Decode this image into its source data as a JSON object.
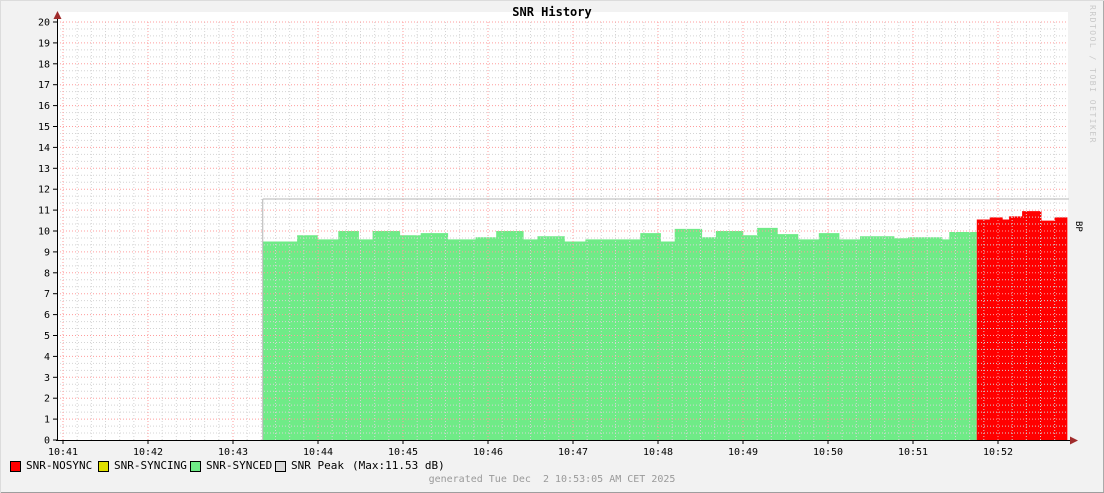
{
  "header": {
    "title": "SNR History"
  },
  "watermark": "RRDTOOL / TOBI OETIKER",
  "right_axis_label": "BP",
  "footer": {
    "generated": "generated Tue Dec  2 10:53:05 AM CET 2025"
  },
  "legend": {
    "items": [
      {
        "label": "SNR-NOSYNC",
        "color": "#FF0000"
      },
      {
        "label": "SNR-SYNCING",
        "color": "#E0E000"
      },
      {
        "label": "SNR-SYNCED",
        "color": "#6FEB87"
      },
      {
        "label": "SNR Peak",
        "color": "#D9D9D9"
      }
    ],
    "max_note": "(Max:11.53 dB)"
  },
  "colors": {
    "plot_background": "#FFFFFF",
    "outer_background": "#F2F2F2",
    "axis": "#000000",
    "arrow": "#A02C2C",
    "grid_major": "#FF9D9D",
    "grid_minor": "#D4D4D4",
    "peak_line": "#B4B4B4",
    "label_text": "#000000",
    "footer_text": "#9A9A9A",
    "watermark_text": "#C9C9C9"
  },
  "chart_data": {
    "type": "area",
    "title": "SNR History",
    "right_axis_label": "BP",
    "ylabel": "",
    "xlabel": "",
    "ylim": [
      0,
      20
    ],
    "y_ticks": [
      0,
      1,
      2,
      3,
      4,
      5,
      6,
      7,
      8,
      9,
      10,
      11,
      12,
      13,
      14,
      15,
      16,
      17,
      18,
      19,
      20
    ],
    "x_ticks": [
      "10:41",
      "10:42",
      "10:43",
      "10:44",
      "10:45",
      "10:46",
      "10:47",
      "10:48",
      "10:49",
      "10:50",
      "10:51",
      "10:52"
    ],
    "x_minor_per_major": 6,
    "y_minor_per_major": 3,
    "grid": true,
    "legend_position": "bottom",
    "sample_seconds": 5,
    "series": [
      {
        "name": "SNR-SYNCED",
        "color": "#6FEB87",
        "start": "10:43:21",
        "end": "10:51:45",
        "rle_values_db": [
          [
            9.5,
            5
          ],
          [
            9.8,
            3
          ],
          [
            9.6,
            3
          ],
          [
            10.0,
            3
          ],
          [
            9.6,
            2
          ],
          [
            10.0,
            4
          ],
          [
            9.8,
            3
          ],
          [
            9.9,
            4
          ],
          [
            9.6,
            4
          ],
          [
            9.7,
            3
          ],
          [
            10.0,
            4
          ],
          [
            9.6,
            2
          ],
          [
            9.75,
            4
          ],
          [
            9.5,
            3
          ],
          [
            9.6,
            8
          ],
          [
            9.9,
            3
          ],
          [
            9.5,
            2
          ],
          [
            10.1,
            4
          ],
          [
            9.7,
            2
          ],
          [
            10.0,
            4
          ],
          [
            9.8,
            2
          ],
          [
            10.15,
            3
          ],
          [
            9.85,
            3
          ],
          [
            9.6,
            3
          ],
          [
            9.9,
            3
          ],
          [
            9.6,
            3
          ],
          [
            9.75,
            5
          ],
          [
            9.65,
            2
          ],
          [
            9.7,
            5
          ],
          [
            9.6,
            1
          ],
          [
            9.95,
            4
          ]
        ]
      },
      {
        "name": "SNR-NOSYNC",
        "color": "#FF0000",
        "start": "10:51:45",
        "end": "10:52:49",
        "rle_values_db": [
          [
            10.55,
            2
          ],
          [
            10.65,
            2
          ],
          [
            10.55,
            1
          ],
          [
            10.7,
            2
          ],
          [
            10.95,
            3
          ],
          [
            10.5,
            2
          ],
          [
            10.65,
            2
          ]
        ]
      },
      {
        "name": "SNR-SYNCING",
        "color": "#E0E000",
        "start": null,
        "end": null,
        "rle_values_db": []
      }
    ],
    "peak": {
      "name": "SNR Peak",
      "max_db": 11.53,
      "line_start": "10:43:21",
      "line_end": "10:52:50",
      "color": "#B4B4B4"
    }
  }
}
